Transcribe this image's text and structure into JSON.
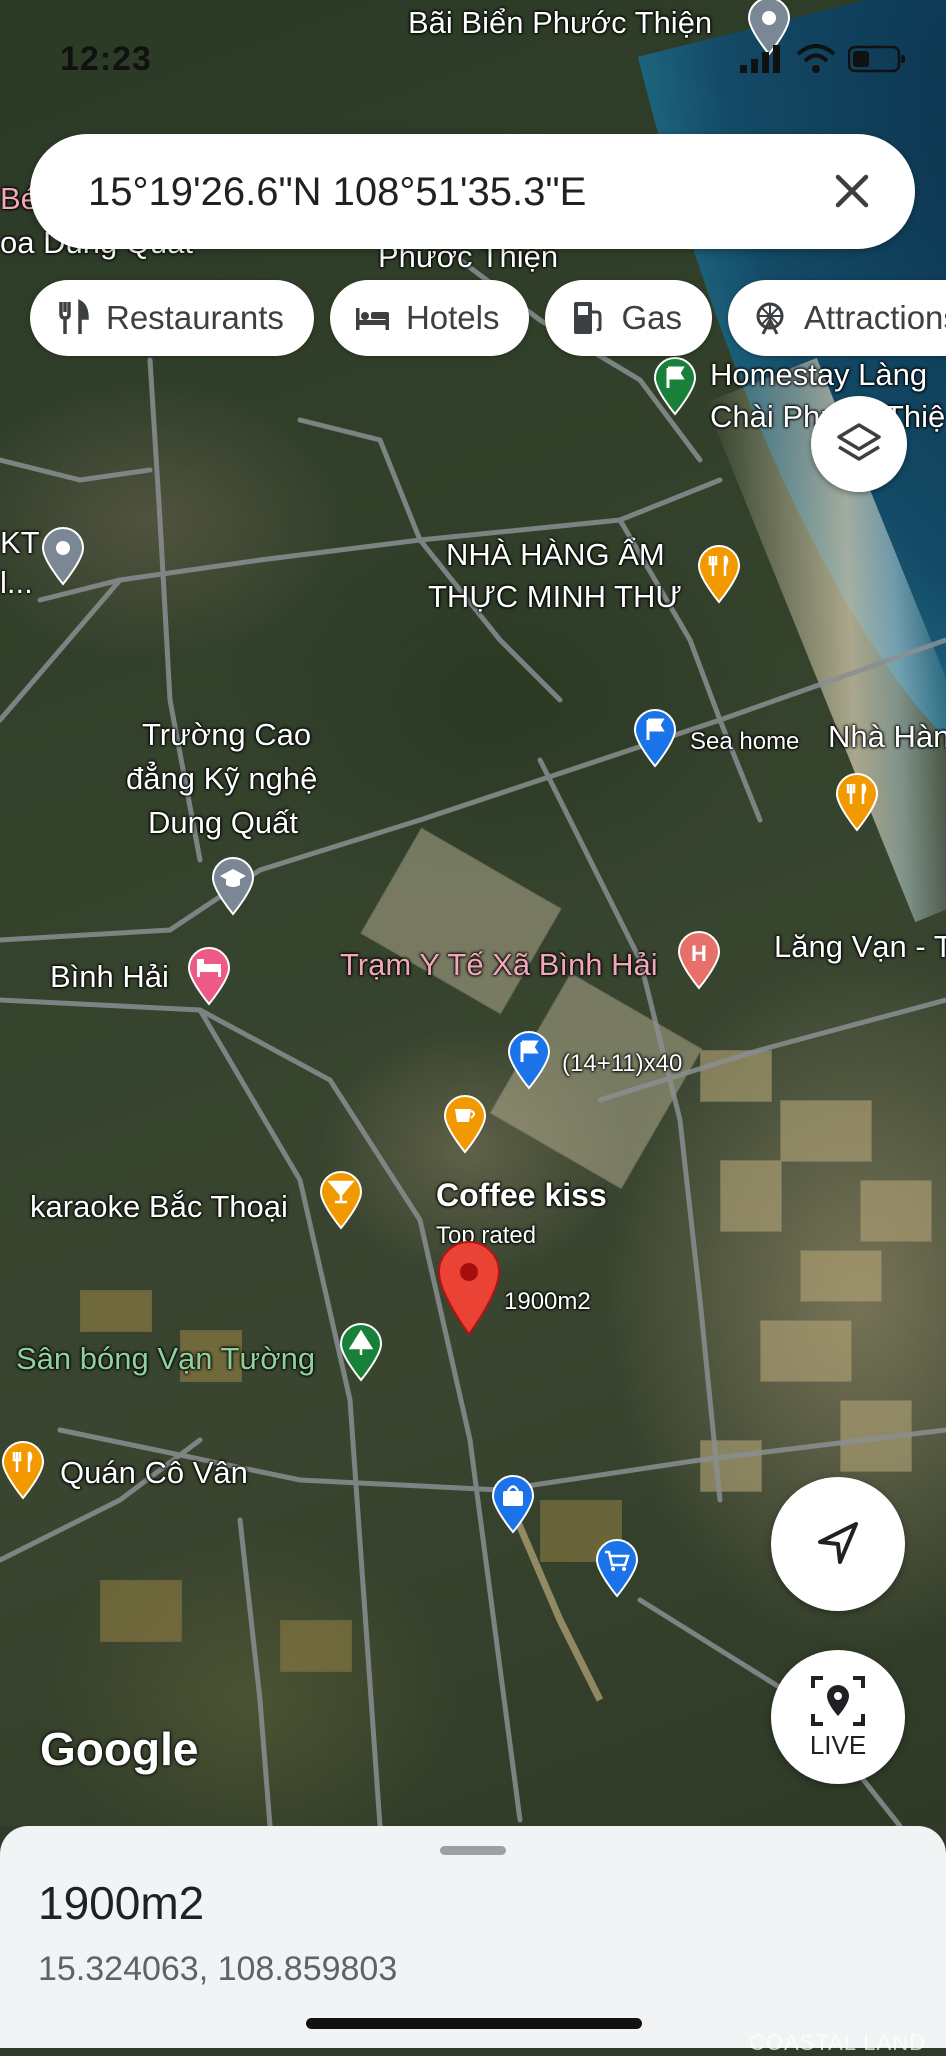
{
  "status_bar": {
    "time": "12:23"
  },
  "search": {
    "query": "15°19'26.6\"N 108°51'35.3\"E"
  },
  "chips": [
    {
      "label": "Restaurants",
      "icon": "fork-knife-icon"
    },
    {
      "label": "Hotels",
      "icon": "bed-icon"
    },
    {
      "label": "Gas",
      "icon": "gas-pump-icon"
    },
    {
      "label": "Attractions",
      "icon": "ferris-wheel-icon"
    }
  ],
  "map_labels": {
    "beach": "Bãi Biển Phước Thiện",
    "phuoc_thien": "Phước Thiện",
    "left_top_1": "Bé",
    "left_top_2": "oa Dung Quất",
    "homestay_1": "Homestay Làng",
    "homestay_2": "Chài Phước Thiệ",
    "kt_1": "KT",
    "kt_2": "l...",
    "nha_hang_1": "NHÀ HÀNG ẨM",
    "nha_hang_2": "THỰC MINH THƯ",
    "sea_home": "Sea home",
    "nha_han_right": "Nhà Hàn",
    "truong_1": "Trường Cao",
    "truong_2": "đẳng Kỹ nghệ",
    "truong_3": "Dung Quất",
    "binh_hai": "Bình Hải",
    "tram_y_te": "Trạm Y Tế Xã Bình Hải",
    "lang_van": "Lăng Vạn - T",
    "lot": "(14+11)x40",
    "karaoke": "karaoke Bắc Thoại",
    "coffee": "Coffee kiss",
    "top_rated": "Top rated",
    "dropped_pin": "1900m2",
    "san_bong": "Sân bóng Vạn Tường",
    "quan_co_van": "Quán Cô Vân"
  },
  "buttons": {
    "live": "LIVE"
  },
  "google_logo": "Google",
  "place": {
    "name": "1900m2",
    "coordinates": "15.324063, 108.859803"
  },
  "watermark": "COASTAL LAND",
  "colors": {
    "pin_red": "#ea4335",
    "pin_blue": "#1a73e8",
    "pin_orange": "#f29900",
    "pin_pink": "#ee5a87",
    "pin_green": "#188038",
    "pin_gray": "#5f6b7a"
  }
}
